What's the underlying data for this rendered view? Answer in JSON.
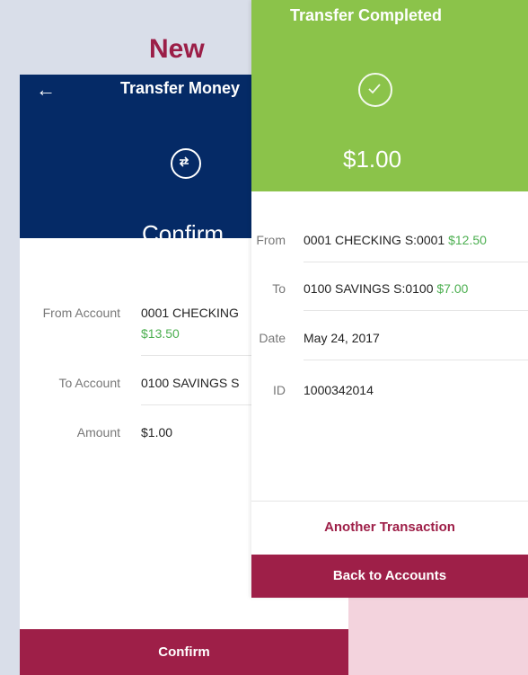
{
  "badge": {
    "new_label": "New"
  },
  "confirm_screen": {
    "header_title": "Transfer Money",
    "heading": "Confirm",
    "rows": [
      {
        "label": "From Account",
        "value": "0001 CHECKING",
        "balance": "$13.50"
      },
      {
        "label": "To Account",
        "value": "0100 SAVINGS S"
      },
      {
        "label": "Amount",
        "value": "$1.00"
      }
    ],
    "button_label": "Confirm"
  },
  "completed_screen": {
    "header_title": "Transfer Completed",
    "amount": "$1.00",
    "rows": [
      {
        "label": "From",
        "value": "0001 CHECKING S:0001",
        "balance": "$12.50"
      },
      {
        "label": "To",
        "value": "0100 SAVINGS S:0100",
        "balance": "$7.00"
      },
      {
        "label": "Date",
        "value": "May 24, 2017"
      },
      {
        "label": "ID",
        "value": "1000342014"
      }
    ],
    "another_label": "Another Transaction",
    "back_label": "Back to Accounts"
  },
  "colors": {
    "navy": "#052a66",
    "green": "#8bc34a",
    "maroon": "#9e1f48",
    "balance_green": "#4caf50"
  }
}
